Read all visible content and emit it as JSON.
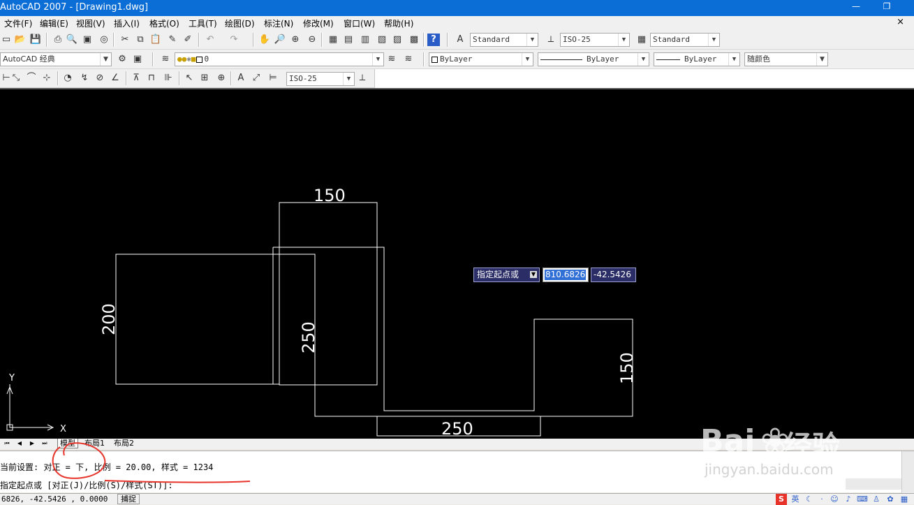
{
  "titlebar": {
    "title": "AutoCAD 2007 - [Drawing1.dwg]",
    "minimize": "—",
    "restore": "❐"
  },
  "menu": {
    "items": [
      "文件(F)",
      "编辑(E)",
      "视图(V)",
      "插入(I)",
      "格式(O)",
      "工具(T)",
      "绘图(D)",
      "标注(N)",
      "修改(M)",
      "窗口(W)",
      "帮助(H)"
    ],
    "doc_close": "×"
  },
  "toolbar1": {
    "text_style": "Standard",
    "dim_style": "ISO-25",
    "table_style": "Standard"
  },
  "toolbar2": {
    "workspace": "AutoCAD 经典",
    "layer": "0",
    "color": "ByLayer",
    "linetype": "ByLayer",
    "lineweight": "ByLayer",
    "plot_style": "随颜色"
  },
  "toolbar3": {
    "dim_style": "ISO-25"
  },
  "drawing": {
    "dims": [
      "150",
      "200",
      "250",
      "150",
      "250"
    ],
    "ucs_y": "Y",
    "ucs_x": "X",
    "line_color": "#ffffff",
    "background": "#000000"
  },
  "dynamic_input": {
    "prompt": "指定起点或",
    "x_value": "810.6826",
    "y_value": "-42.5426"
  },
  "tabs": {
    "items": [
      "模型",
      "布局1",
      "布局2"
    ],
    "active": "模型"
  },
  "command": {
    "line1": "当前设置: 对正 = 下, 比例 = 20.00, 样式 = 1234",
    "line2": "指定起点或 [对正(J)/比例(S)/样式(ST)]:"
  },
  "status": {
    "coords": "6826, -42.5426 , 0.0000",
    "snap": "捕捉"
  },
  "watermark": {
    "brand": "Bai",
    "brand2": "经验",
    "url": "jingyan.baidu.com"
  },
  "ime": {
    "lang": "英"
  },
  "annotation_color": "#e8332a"
}
